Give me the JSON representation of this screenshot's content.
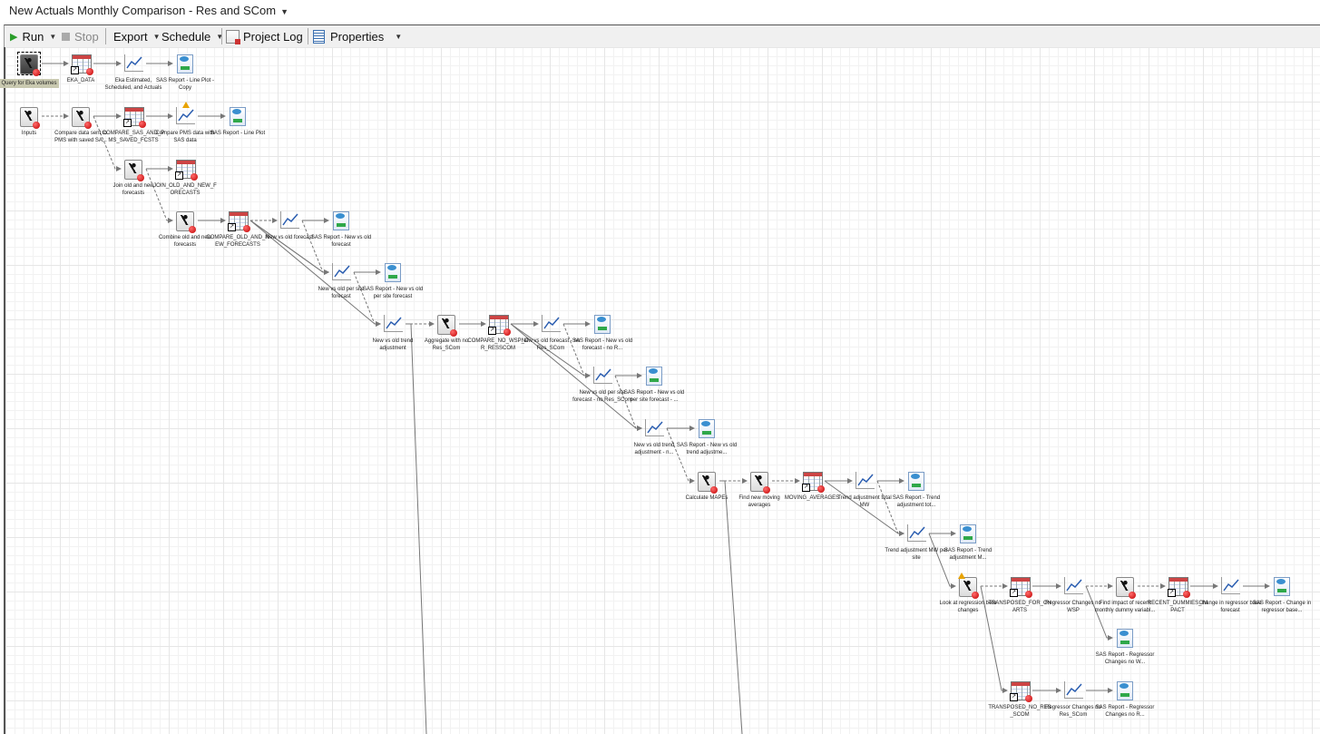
{
  "window": {
    "title": "New Actuals Monthly Comparison - Res and SCom"
  },
  "toolbar": {
    "run_label": "Run",
    "stop_label": "Stop",
    "export_label": "Export",
    "schedule_label": "Schedule",
    "project_log_label": "Project Log",
    "properties_label": "Properties"
  },
  "nodes": [
    {
      "id": "n1",
      "type": "program",
      "label": "Query for Eka volumes",
      "selected": true
    },
    {
      "id": "n2",
      "type": "data",
      "label": "EKA_DATA"
    },
    {
      "id": "n3",
      "type": "chart",
      "label": "Eka Estimated, Scheduled, and Actuals"
    },
    {
      "id": "n4",
      "type": "report",
      "label": "SAS Report - Line Plot - Copy"
    },
    {
      "id": "n5",
      "type": "program",
      "label": "Inputs"
    },
    {
      "id": "n6",
      "type": "program",
      "label": "Compare data sent to PMS with saved SA..."
    },
    {
      "id": "n7",
      "type": "data",
      "label": "COMPARE_SAS_AND_PMS_SAVED_FCSTS"
    },
    {
      "id": "n8",
      "type": "chart",
      "label": "Compare PMS data with SAS data",
      "warning": true
    },
    {
      "id": "n9",
      "type": "report",
      "label": "SAS Report - Line Plot"
    },
    {
      "id": "n10",
      "type": "program",
      "label": "Join old and new forecasts"
    },
    {
      "id": "n11",
      "type": "data",
      "label": "JOIN_OLD_AND_NEW_FORECASTS"
    },
    {
      "id": "n12",
      "type": "program",
      "label": "Combine old and new forecasts"
    },
    {
      "id": "n13",
      "type": "data",
      "label": "COMPARE_OLD_AND_NEW_FORECASTS"
    },
    {
      "id": "n14",
      "type": "chart",
      "label": "New vs old forecast"
    },
    {
      "id": "n15",
      "type": "report",
      "label": "SAS Report - New vs old forecast"
    },
    {
      "id": "n16",
      "type": "chart",
      "label": "New vs old per site forecast"
    },
    {
      "id": "n17",
      "type": "report",
      "label": "SAS Report - New vs old per site forecast"
    },
    {
      "id": "n18",
      "type": "chart",
      "label": "New vs old trend adjustment"
    },
    {
      "id": "n19",
      "type": "program",
      "label": "Aggregate with no Res_SCom"
    },
    {
      "id": "n20",
      "type": "data",
      "label": "COMPARE_NO_WSP_OR_RESSCOM"
    },
    {
      "id": "n21",
      "type": "chart",
      "label": "New vs old forecast - no Res_SCom"
    },
    {
      "id": "n22",
      "type": "report",
      "label": "SAS Report - New vs old forecast - no R..."
    },
    {
      "id": "n23",
      "type": "chart",
      "label": "New vs old per site forecast - no Res_SCom"
    },
    {
      "id": "n24",
      "type": "report",
      "label": "SAS Report - New vs old per site forecast - ..."
    },
    {
      "id": "n25",
      "type": "chart",
      "label": "New vs old trend adjustment - n..."
    },
    {
      "id": "n26",
      "type": "report",
      "label": "SAS Report - New vs old trend adjustme..."
    },
    {
      "id": "n27",
      "type": "program",
      "label": "Calculate MAPEs"
    },
    {
      "id": "n28",
      "type": "program",
      "label": "Find new moving averages"
    },
    {
      "id": "n29",
      "type": "data",
      "label": "MOVING_AVERAGES"
    },
    {
      "id": "n30",
      "type": "chart",
      "label": "Trend adjustment total MW"
    },
    {
      "id": "n31",
      "type": "report",
      "label": "SAS Report - Trend adjustment tot..."
    },
    {
      "id": "n32",
      "type": "chart",
      "label": "Trend adjustment MW per site"
    },
    {
      "id": "n33",
      "type": "report",
      "label": "SAS Report - Trend adjustment M..."
    },
    {
      "id": "n34",
      "type": "program",
      "label": "Look at regression beta changes",
      "warning": true
    },
    {
      "id": "n35",
      "type": "data",
      "label": "TRANSPOSED_FOR_CHARTS"
    },
    {
      "id": "n36",
      "type": "chart",
      "label": "Regressor Changes no WSP"
    },
    {
      "id": "n37",
      "type": "program",
      "label": "Find impact of recent monthly dummy variabl..."
    },
    {
      "id": "n38",
      "type": "data",
      "label": "RECENT_DUMMIES_IMPACT"
    },
    {
      "id": "n39",
      "type": "chart",
      "label": "Change in regressor base forecast"
    },
    {
      "id": "n40",
      "type": "report",
      "label": "SAS Report - Change in regressor base..."
    },
    {
      "id": "n41",
      "type": "report",
      "label": "SAS Report - Regressor Changes no W..."
    },
    {
      "id": "n42",
      "type": "data",
      "label": "TRANSPOSED_NO_RES_SCOM"
    },
    {
      "id": "n43",
      "type": "chart",
      "label": "Regressor Changes no Res_SCom"
    },
    {
      "id": "n44",
      "type": "report",
      "label": "SAS Report - Regressor Changes no R..."
    }
  ]
}
